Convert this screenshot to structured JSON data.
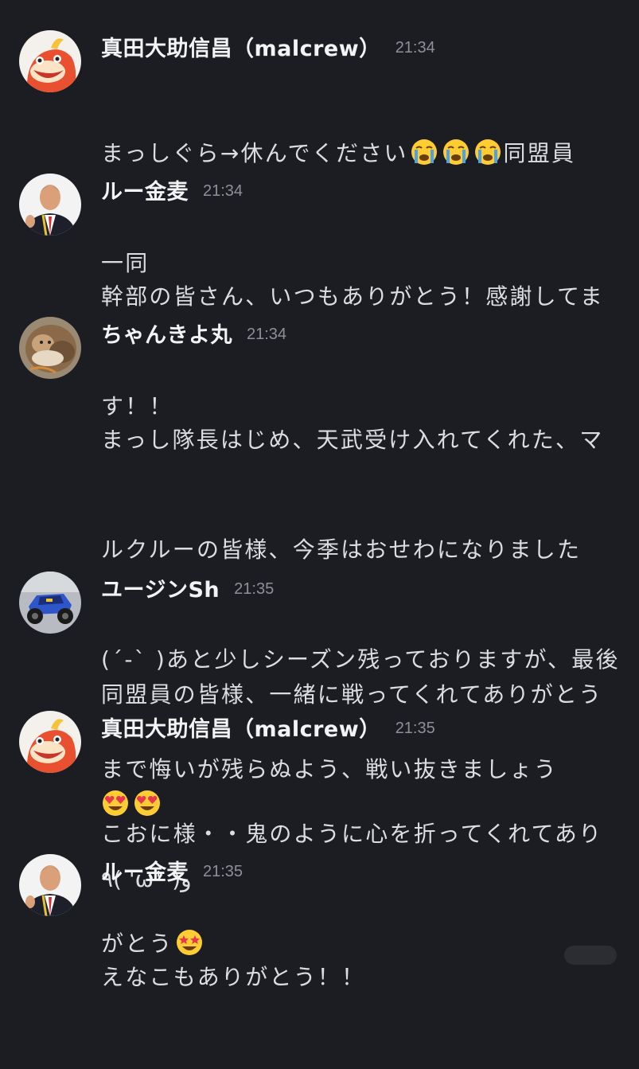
{
  "messages": [
    {
      "author": "真田大助信昌（malcrew）",
      "time": "21:34",
      "avatar": "fuecoco-avatar",
      "lines": [
        "まっしぐら→休んでください",
        "一同"
      ],
      "inline_after_line0": [
        "crying-face-emoji",
        "crying-face-emoji",
        "crying-face-emoji"
      ],
      "line0_suffix": "同盟員"
    },
    {
      "author": "ルー金麦",
      "time": "21:34",
      "avatar": "man-in-suit-avatar",
      "lines": [
        "幹部の皆さん、いつもありがとう！感謝してま",
        "す！！"
      ]
    },
    {
      "author": "ちゃんきよ丸",
      "time": "21:34",
      "avatar": "cat-photo-avatar",
      "lines": [
        "まっし隊長はじめ、天武受け入れてくれた、マ",
        "ルクルーの皆様、今季はおせわになりました",
        "(´-` )あと少しシーズン残っておりますが、最後",
        "まで悔いが残らぬよう、戦い抜きましょう",
        "٩( 'ω' )و"
      ]
    },
    {
      "author": "ユージンSh",
      "time": "21:35",
      "avatar": "rc-car-avatar",
      "lines": [
        "同盟員の皆様、一緒に戦ってくれてありがとう"
      ],
      "emoji_line": [
        "heart-eyes-emoji",
        "heart-eyes-emoji"
      ]
    },
    {
      "author": "真田大助信昌（malcrew）",
      "time": "21:35",
      "avatar": "fuecoco-avatar",
      "lines": [
        "こおに様・・鬼のように心を折ってくれてあり",
        "がとう"
      ],
      "line1_emoji": "star-struck-emoji"
    },
    {
      "author": "ルー金麦",
      "time": "21:35",
      "avatar": "man-in-suit-avatar",
      "lines": [
        "えなこもありがとう！！"
      ]
    }
  ],
  "colors": {
    "background": "#1c1d22",
    "author": "#f2f3f5",
    "text": "#dcdde0",
    "time": "#8e9097"
  }
}
